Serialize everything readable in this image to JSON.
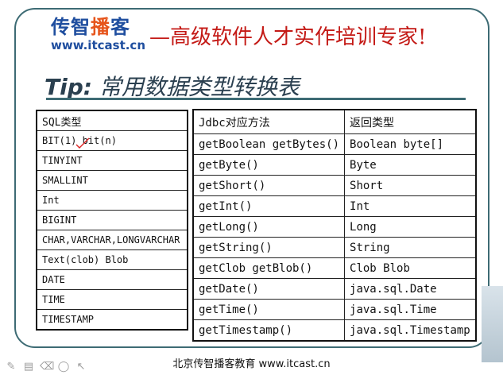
{
  "brand": {
    "name_part1": "传智",
    "name_accent": "播",
    "name_part2": "客",
    "url": "www.itcast.cn"
  },
  "slogan": "—高级软件人才实作培训专家!",
  "tip": {
    "label": "Tip:",
    "title": "常用数据类型转换表"
  },
  "sql_table": {
    "header": "SQL类型",
    "rows": [
      "BIT(1) bit(n)",
      "TINYINT",
      "SMALLINT",
      "Int",
      "BIGINT",
      "CHAR,VARCHAR,LONGVARCHAR",
      "Text(clob)  Blob",
      "DATE",
      "TIME",
      "TIMESTAMP"
    ]
  },
  "jdbc_table": {
    "headers": [
      "Jdbc对应方法",
      "返回类型"
    ],
    "rows": [
      [
        "getBoolean getBytes()",
        "Boolean byte[]"
      ],
      [
        "getByte()",
        "Byte"
      ],
      [
        "getShort()",
        "Short"
      ],
      [
        "getInt()",
        "Int"
      ],
      [
        "getLong()",
        "Long"
      ],
      [
        "getString()",
        "String"
      ],
      [
        "getClob getBlob()",
        "Clob  Blob"
      ],
      [
        "getDate()",
        "java.sql.Date"
      ],
      [
        "getTime()",
        "java.sql.Time"
      ],
      [
        "getTimestamp()",
        "java.sql.Timestamp"
      ]
    ]
  },
  "footer": "北京传智播客教育 www.itcast.cn",
  "toolbar_icons": [
    "pen-icon",
    "slides-icon",
    "eraser-icon",
    "record-icon",
    "pointer-icon"
  ],
  "colors": {
    "brand_blue": "#1f4e9f",
    "brand_accent": "#e6541b",
    "slogan_red": "#c41a16",
    "frame": "#3d6b74"
  }
}
